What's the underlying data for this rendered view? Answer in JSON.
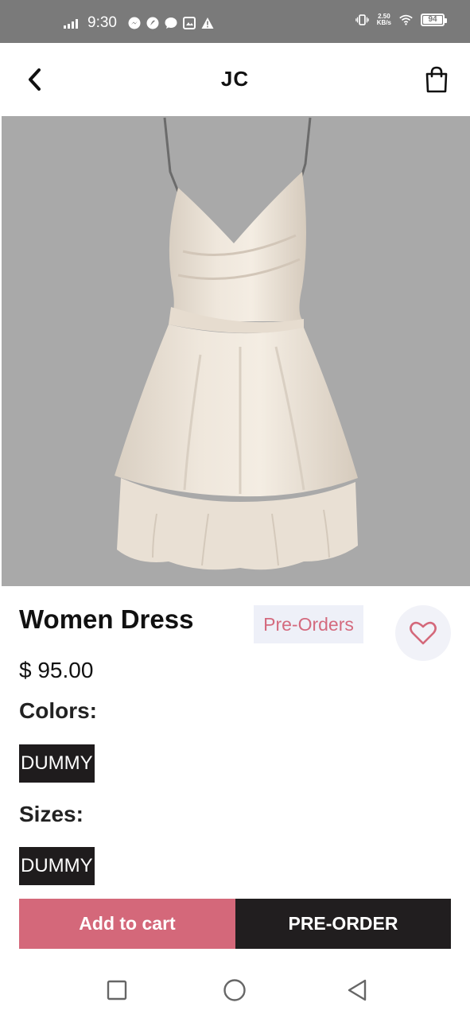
{
  "status_bar": {
    "time": "9:30",
    "net_speed_value": "2.50",
    "net_speed_unit": "KB/s",
    "battery_level": "94",
    "battery_fraction": 0.94
  },
  "app_bar": {
    "title": "JC"
  },
  "product": {
    "image_icon": "dress-image",
    "name": "Women Dress",
    "badge": "Pre-Orders",
    "price": "$ 95.00",
    "colors_label": "Colors:",
    "color_value": "DUMMY",
    "sizes_label": "Sizes:",
    "size_value": "DUMMY"
  },
  "actions": {
    "add_to_cart": "Add to cart",
    "pre_order": "PRE-ORDER"
  },
  "colors": {
    "accent": "#d4687a",
    "dark": "#211e1f",
    "badge_bg": "#eef0f8",
    "image_bg": "#a9a9a9",
    "status_bar": "#7a7a7a"
  }
}
